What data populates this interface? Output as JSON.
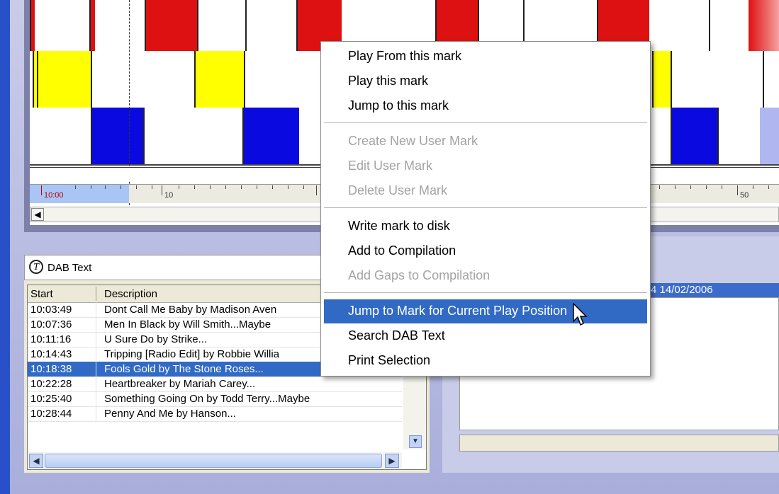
{
  "colors": {
    "red": "#dd1111",
    "yellow": "#ffff00",
    "blue": "#0a0ae0",
    "selection": "#316ac5",
    "faded_blue": "#b0b7f0"
  },
  "timeline": {
    "ruler_labels": {
      "start": "10:00",
      "ten": "10",
      "fifty": "50"
    },
    "scroll_left_icon": "chevron-left-icon"
  },
  "dab": {
    "title": "DAB Text",
    "icon": "dab-text-icon",
    "columns": {
      "start": "Start",
      "description": "Description"
    },
    "rows": [
      {
        "start": "10:03:49",
        "desc": "Dont Call Me Baby by Madison Aven"
      },
      {
        "start": "10:07:36",
        "desc": "Men In Black by Will Smith...Maybe"
      },
      {
        "start": "10:11:16",
        "desc": "U Sure Do by Strike..."
      },
      {
        "start": "10:14:43",
        "desc": "Tripping [Radio Edit] by Robbie Willia"
      },
      {
        "start": "10:18:38",
        "desc": "Fools Gold by The Stone Roses..."
      },
      {
        "start": "10:22:28",
        "desc": "Heartbreaker by Mariah Carey..."
      },
      {
        "start": "10:25:40",
        "desc": "Something Going On by Todd Terry...Maybe"
      },
      {
        "start": "10:28:44",
        "desc": "Penny And Me by Hanson..."
      }
    ],
    "selected_index": 4
  },
  "right_panel": {
    "bar_text": "4 14/02/2006"
  },
  "context_menu": {
    "items": [
      {
        "label": "Play From this mark",
        "enabled": true
      },
      {
        "label": "Play this mark",
        "enabled": true
      },
      {
        "label": "Jump to this mark",
        "enabled": true
      },
      {
        "label": "Create New User Mark",
        "enabled": false
      },
      {
        "label": "Edit User Mark",
        "enabled": false
      },
      {
        "label": "Delete User Mark",
        "enabled": false
      },
      {
        "label": "Write mark to disk",
        "enabled": true
      },
      {
        "label": "Add to Compilation",
        "enabled": true
      },
      {
        "label": "Add Gaps to Compilation",
        "enabled": false
      },
      {
        "label": "Jump to Mark for Current Play Position",
        "enabled": true,
        "highlighted": true
      },
      {
        "label": "Search DAB Text",
        "enabled": true
      },
      {
        "label": "Print Selection",
        "enabled": true
      }
    ]
  }
}
